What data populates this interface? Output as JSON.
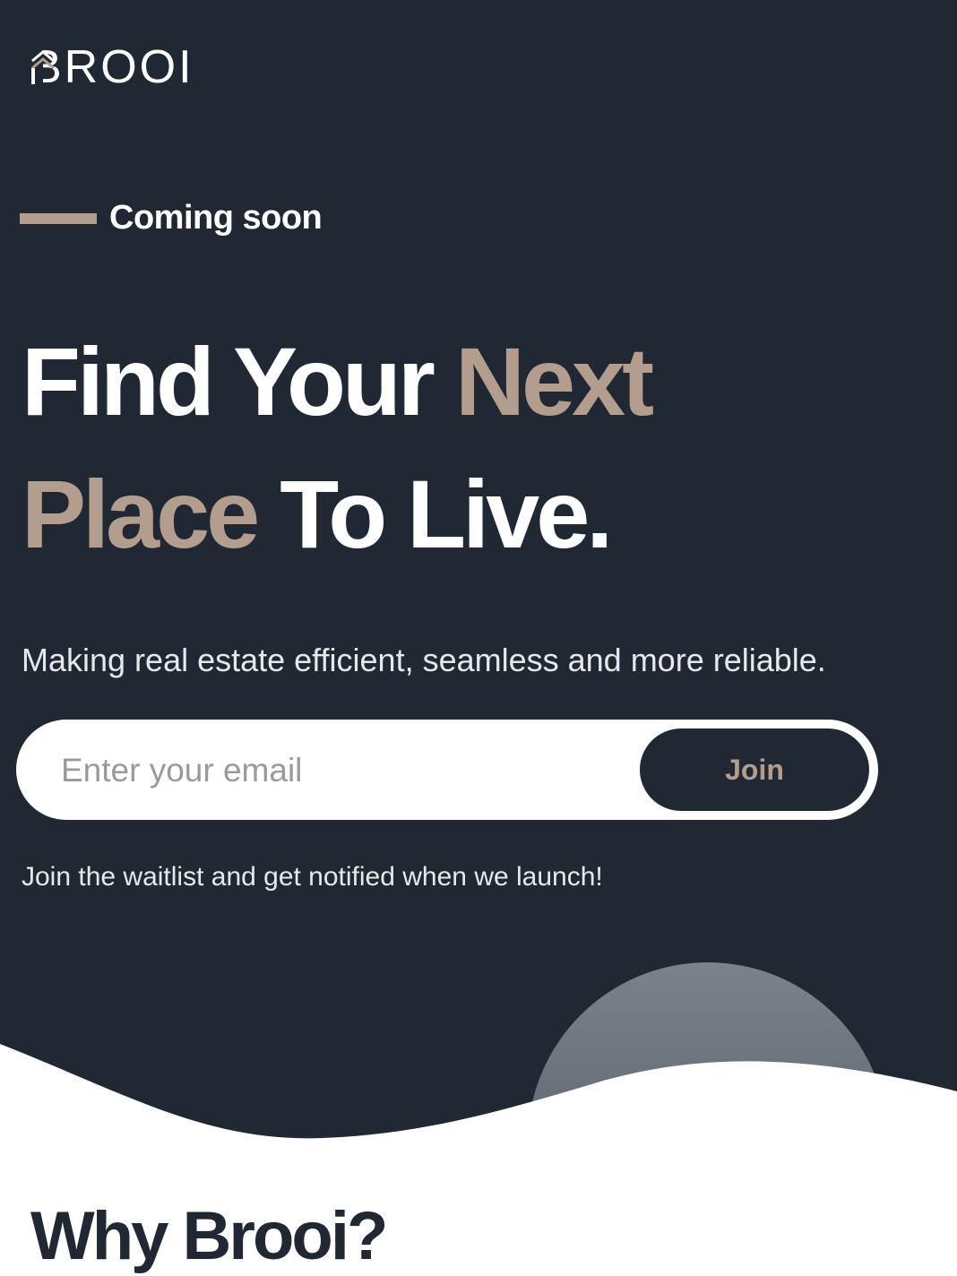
{
  "brand": {
    "name": "BROOI"
  },
  "hero": {
    "eyebrow": "Coming soon",
    "headline": {
      "part1": "Find Your ",
      "accent1": "Next",
      "accent2": "Place",
      "part2": "To Live."
    },
    "subtitle": "Making real estate efficient, seamless and more reliable.",
    "email_placeholder": "Enter your email",
    "join_label": "Join",
    "waitlist_note": "Join the waitlist and get notified when we launch!"
  },
  "section": {
    "why_title": "Why Brooi?"
  },
  "colors": {
    "background": "#202933",
    "accent": "#b39e8d",
    "text": "#ffffff"
  },
  "icons": {
    "logo_mark": "house-roof-icon"
  }
}
